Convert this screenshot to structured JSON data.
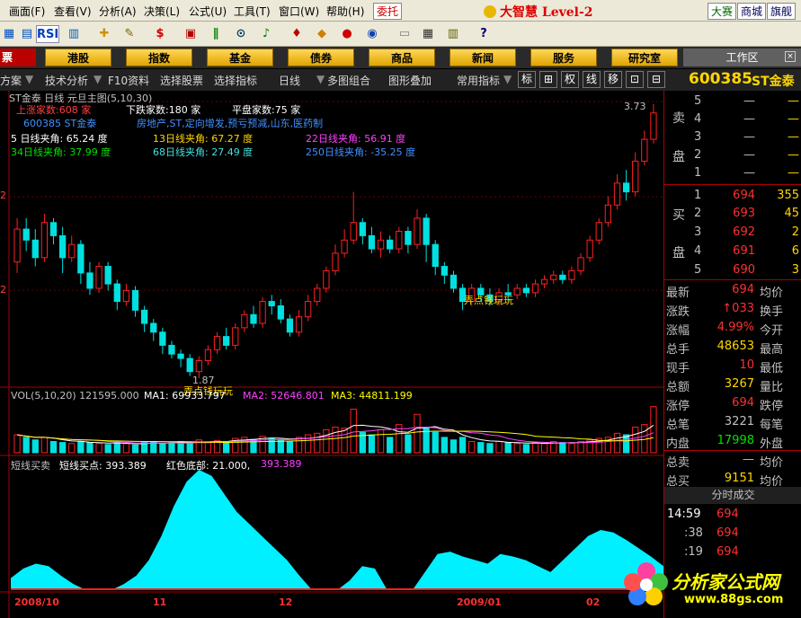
{
  "menu": [
    "画面(F)",
    "查看(V)",
    "分析(A)",
    "决策(L)",
    "公式(U)",
    "工具(T)",
    "窗口(W)",
    "帮助(H)"
  ],
  "menu_tag": "委托",
  "brand": "大智慧 Level-2",
  "top_tags": [
    "大赛",
    "商城",
    "旗舰"
  ],
  "toolbar_text": [
    "RSI"
  ],
  "market_first": "票",
  "market_tabs": [
    "港股",
    "指数",
    "基金",
    "债券",
    "商品",
    "新闻",
    "服务",
    "研究室"
  ],
  "workarea": "工作区",
  "funcbar": {
    "items": [
      "方案",
      "技术分析",
      "F10资料",
      "选择股票",
      "选择指标",
      "日线",
      "多图组合",
      "图形叠加",
      "常用指标"
    ],
    "icons": [
      "标",
      "⊞",
      "权",
      "线",
      "移",
      "⊡",
      "⊟"
    ]
  },
  "chart": {
    "header": "ST金泰 日线 元旦主图(5,10,30)",
    "up_count": "上涨家数:608 家",
    "down_count": "下跌家数:180 家",
    "flat_count": "平盘家数:75 家",
    "stock_desc": "600385 ST金泰",
    "stock_tags": "房地产,ST,定向增发,预亏预减,山东,医药制",
    "angle_5": "5 日线夹角: 65.24 度",
    "angle_13": "13日线夹角: 67.27 度",
    "angle_22": "22日线夹角: 56.91 度",
    "angle_34": "34日线夹角: 37.99 度",
    "angle_68": "68日线夹角: 27.49 度",
    "angle_250": "250日线夹角: -35.25 度",
    "high_label": "3.73",
    "low_label": "1.87",
    "annot_mid": "弄点钱玩玩",
    "annot_low": "弄点钱玩玩",
    "y_ticks": [
      "2",
      "2",
      "2"
    ],
    "vol_header": {
      "vol": "VOL(5,10,20) 121595.000",
      "ma1": "MA1: 69933.797",
      "ma2": "MA2: 52646.801",
      "ma3": "MA3: 44811.199"
    },
    "ind_header": {
      "name": "短线买卖",
      "buy": "短线买点: 393.389",
      "red": "红色底部: 21.000,",
      "val": "393.389"
    },
    "x_labels": [
      "2008/10",
      "11",
      "12",
      "2009/01",
      "02"
    ]
  },
  "chart_data": {
    "type": "candlestick",
    "title": "ST金泰 日线",
    "candles": [
      [
        2.1,
        2.25,
        2.05,
        2.3
      ],
      [
        2.25,
        2.2,
        2.15,
        2.3
      ],
      [
        2.2,
        2.12,
        2.08,
        2.25
      ],
      [
        2.12,
        2.28,
        2.1,
        2.32
      ],
      [
        2.28,
        2.22,
        2.18,
        2.3
      ],
      [
        2.22,
        2.12,
        2.05,
        2.26
      ],
      [
        2.12,
        2.18,
        2.1,
        2.22
      ],
      [
        2.18,
        2.05,
        2.0,
        2.2
      ],
      [
        2.05,
        1.98,
        1.95,
        2.1
      ],
      [
        1.98,
        2.08,
        1.96,
        2.1
      ],
      [
        2.08,
        2.0,
        1.97,
        2.1
      ],
      [
        2.0,
        1.92,
        1.88,
        2.02
      ],
      [
        1.92,
        1.97,
        1.9,
        2.0
      ],
      [
        1.97,
        1.88,
        1.85,
        1.99
      ],
      [
        1.88,
        1.82,
        1.78,
        1.9
      ],
      [
        1.82,
        1.78,
        1.74,
        1.84
      ],
      [
        1.78,
        1.72,
        1.68,
        1.8
      ],
      [
        1.72,
        1.68,
        1.66,
        1.74
      ],
      [
        1.68,
        1.66,
        1.62,
        1.7
      ],
      [
        1.66,
        1.6,
        1.58,
        1.68
      ],
      [
        1.6,
        1.65,
        1.57,
        1.67
      ],
      [
        1.65,
        1.7,
        1.63,
        1.72
      ],
      [
        1.7,
        1.76,
        1.68,
        1.78
      ],
      [
        1.76,
        1.72,
        1.7,
        1.8
      ],
      [
        1.72,
        1.8,
        1.7,
        1.82
      ],
      [
        1.8,
        1.86,
        1.78,
        1.88
      ],
      [
        1.86,
        1.82,
        1.8,
        1.9
      ],
      [
        1.82,
        1.92,
        1.8,
        1.94
      ],
      [
        1.92,
        1.9,
        1.86,
        1.95
      ],
      [
        1.9,
        1.84,
        1.82,
        1.93
      ],
      [
        1.84,
        1.78,
        1.76,
        1.86
      ],
      [
        1.78,
        1.85,
        1.76,
        1.88
      ],
      [
        1.85,
        1.92,
        1.83,
        1.95
      ],
      [
        1.92,
        1.98,
        1.9,
        2.0
      ],
      [
        1.98,
        2.06,
        1.96,
        2.08
      ],
      [
        2.06,
        2.14,
        2.04,
        2.18
      ],
      [
        2.14,
        2.2,
        2.12,
        2.25
      ],
      [
        2.2,
        2.28,
        2.18,
        2.42
      ],
      [
        2.28,
        2.22,
        2.18,
        2.3
      ],
      [
        2.22,
        2.16,
        2.14,
        2.26
      ],
      [
        2.16,
        2.2,
        2.12,
        2.24
      ],
      [
        2.2,
        2.16,
        2.14,
        2.22
      ],
      [
        2.16,
        2.24,
        2.14,
        2.26
      ],
      [
        2.24,
        2.18,
        2.14,
        2.26
      ],
      [
        2.18,
        2.3,
        2.16,
        2.34
      ],
      [
        2.3,
        2.18,
        2.1,
        2.32
      ],
      [
        2.18,
        2.08,
        2.04,
        2.2
      ],
      [
        2.08,
        2.04,
        2.0,
        2.1
      ],
      [
        2.04,
        1.98,
        1.96,
        2.06
      ],
      [
        1.98,
        1.92,
        1.88,
        2.0
      ],
      [
        1.92,
        1.98,
        1.9,
        2.0
      ],
      [
        1.98,
        1.95,
        1.92,
        2.0
      ],
      [
        1.95,
        1.92,
        1.9,
        1.98
      ],
      [
        1.92,
        1.96,
        1.9,
        1.98
      ],
      [
        1.96,
        1.95,
        1.92,
        2.0
      ],
      [
        1.95,
        1.98,
        1.93,
        2.0
      ],
      [
        1.98,
        1.96,
        1.94,
        2.0
      ],
      [
        1.96,
        2.0,
        1.94,
        2.02
      ],
      [
        2.0,
        2.02,
        1.98,
        2.04
      ],
      [
        2.02,
        2.04,
        2.0,
        2.06
      ],
      [
        2.04,
        2.02,
        2.0,
        2.06
      ],
      [
        2.02,
        2.06,
        2.0,
        2.08
      ],
      [
        2.06,
        2.12,
        2.04,
        2.14
      ],
      [
        2.12,
        2.2,
        2.1,
        2.22
      ],
      [
        2.2,
        2.28,
        2.18,
        2.3
      ],
      [
        2.28,
        2.36,
        2.26,
        2.4
      ],
      [
        2.36,
        2.46,
        2.34,
        2.5
      ],
      [
        2.46,
        2.42,
        2.38,
        2.52
      ],
      [
        2.42,
        2.56,
        2.4,
        2.6
      ],
      [
        2.56,
        2.66,
        2.54,
        2.7
      ],
      [
        2.66,
        2.78,
        2.64,
        2.82
      ]
    ],
    "volume_profile": [
      0.35,
      0.3,
      0.25,
      0.3,
      0.22,
      0.2,
      0.18,
      0.22,
      0.2,
      0.18,
      0.16,
      0.2,
      0.18,
      0.15,
      0.2,
      0.22,
      0.18,
      0.2,
      0.22,
      0.18,
      0.25,
      0.2,
      0.24,
      0.22,
      0.28,
      0.3,
      0.26,
      0.32,
      0.28,
      0.25,
      0.22,
      0.3,
      0.35,
      0.38,
      0.45,
      0.5,
      0.48,
      0.85,
      0.4,
      0.35,
      0.45,
      0.3,
      0.55,
      0.35,
      0.75,
      0.5,
      0.4,
      0.3,
      0.25,
      0.3,
      0.22,
      0.2,
      0.18,
      0.22,
      0.2,
      0.18,
      0.16,
      0.2,
      0.18,
      0.22,
      0.2,
      0.18,
      0.22,
      0.25,
      0.28,
      0.3,
      0.38,
      0.35,
      0.5,
      0.55,
      0.9
    ],
    "indicator_profile": [
      0.1,
      0.18,
      0.22,
      0.2,
      0.12,
      0.05,
      0.0,
      0.0,
      0.0,
      0.05,
      0.12,
      0.25,
      0.45,
      0.7,
      0.9,
      1.0,
      0.95,
      0.8,
      0.65,
      0.55,
      0.45,
      0.35,
      0.25,
      0.12,
      0.0,
      0.0,
      0.0,
      0.08,
      0.2,
      0.18,
      0.0,
      0.0,
      0.0,
      0.15,
      0.3,
      0.32,
      0.28,
      0.25,
      0.22,
      0.3,
      0.28,
      0.25,
      0.2,
      0.15,
      0.25,
      0.35,
      0.45,
      0.5,
      0.48,
      0.42,
      0.35,
      0.28,
      0.2
    ],
    "high": 3.73,
    "low": 1.87
  },
  "quote": {
    "code": "600385",
    "name": "ST金泰",
    "sell_label": [
      "卖",
      "盘"
    ],
    "buy_label": [
      "买",
      "盘"
    ],
    "sell": [
      {
        "n": "5",
        "p": "—",
        "v": "—"
      },
      {
        "n": "4",
        "p": "—",
        "v": "—"
      },
      {
        "n": "3",
        "p": "—",
        "v": "—"
      },
      {
        "n": "2",
        "p": "—",
        "v": "—"
      },
      {
        "n": "1",
        "p": "—",
        "v": "—"
      }
    ],
    "buy": [
      {
        "n": "1",
        "p": "694",
        "v": "355"
      },
      {
        "n": "2",
        "p": "693",
        "v": "45"
      },
      {
        "n": "3",
        "p": "692",
        "v": "2"
      },
      {
        "n": "4",
        "p": "691",
        "v": "6"
      },
      {
        "n": "5",
        "p": "690",
        "v": "3"
      }
    ],
    "stats": [
      {
        "l": "最新",
        "v": "694",
        "c": "#ff3030",
        "r": "均价"
      },
      {
        "l": "涨跌",
        "v": "↑033",
        "c": "#ff3030",
        "r": "换手"
      },
      {
        "l": "涨幅",
        "v": "4.99%",
        "c": "#ff3030",
        "r": "今开"
      },
      {
        "l": "总手",
        "v": "48653",
        "c": "#ffd700",
        "r": "最高"
      },
      {
        "l": "现手",
        "v": "10",
        "c": "#ff3030",
        "r": "最低"
      },
      {
        "l": "总额",
        "v": "3267",
        "c": "#ffd700",
        "r": "量比"
      },
      {
        "l": "涨停",
        "v": "694",
        "c": "#ff3030",
        "r": "跌停"
      },
      {
        "l": "总笔",
        "v": "3221",
        "c": "#c0c0c0",
        "r": "每笔"
      },
      {
        "l": "内盘",
        "v": "17998",
        "c": "#00e000",
        "r": "外盘"
      }
    ],
    "total_sell": {
      "l": "总卖",
      "v": "—",
      "r": "均价"
    },
    "total_buy": {
      "l": "总买",
      "v": "9151",
      "r": "均价"
    },
    "ts_header": "分时成交",
    "ticks": [
      {
        "t": "14:59",
        "p": "694"
      },
      {
        "t": ":38",
        "p": "694"
      },
      {
        "t": ":19",
        "p": "694"
      }
    ]
  },
  "watermark": {
    "title": "分析家公式网",
    "url": "www.88gs.com"
  },
  "colors": {
    "up": "#ff2020",
    "down": "#00e0e0",
    "accent": "#ffd700",
    "ma1": "#ffffff",
    "ma2": "#ff40ff",
    "ma3": "#ffff00"
  }
}
